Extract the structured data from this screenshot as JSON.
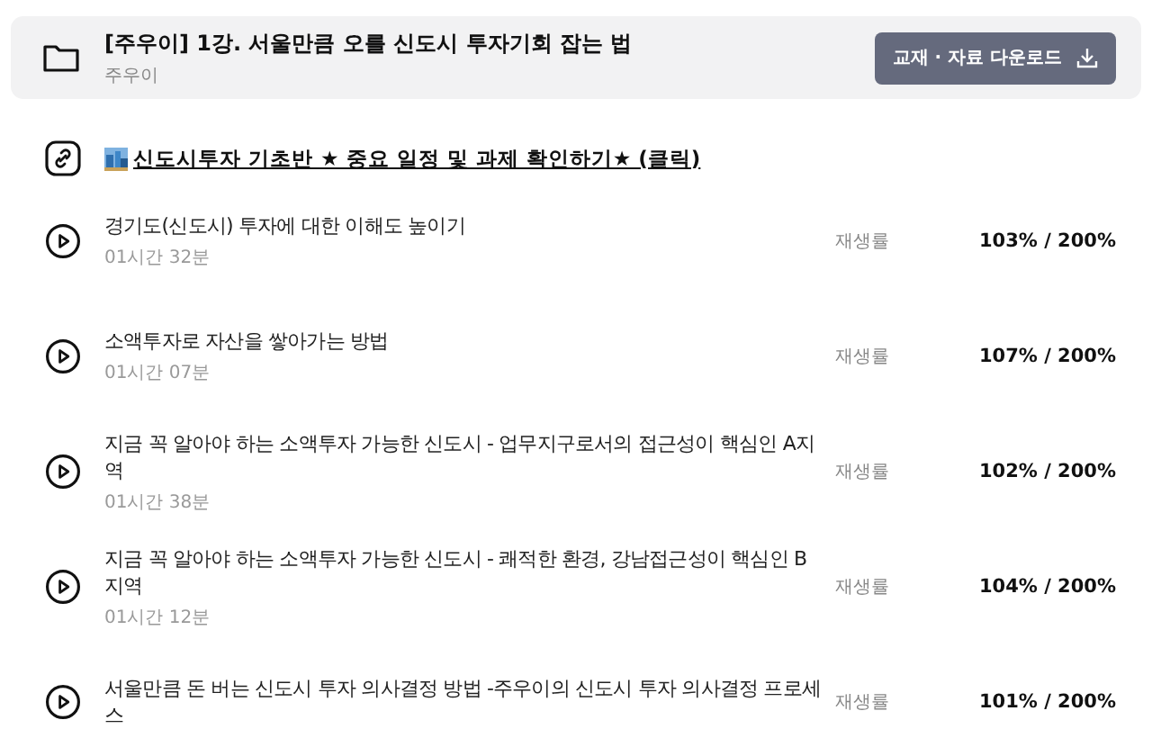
{
  "course": {
    "title": "[주우이] 1강. 서울만큼 오를 신도시 투자기회 잡는 법",
    "author": "주우이",
    "download_button": "교재 · 자료 다운로드"
  },
  "link": {
    "text": "신도시투자 기초반 ★ 중요 일정 및 과제 확인하기★ (클릭)"
  },
  "lessons": [
    {
      "title": "경기도(신도시) 투자에 대한 이해도 높이기",
      "duration": "01시간 32분",
      "rate_label": "재생률",
      "rate": "103% / 200%"
    },
    {
      "title": "소액투자로 자산을 쌓아가는 방법",
      "duration": "01시간 07분",
      "rate_label": "재생률",
      "rate": "107% / 200%"
    },
    {
      "title": "지금 꼭 알아야 하는 소액투자 가능한 신도시 - 업무지구로서의 접근성이 핵심인 A지역",
      "duration": "01시간 38분",
      "rate_label": "재생률",
      "rate": "102% / 200%"
    },
    {
      "title": "지금 꼭 알아야 하는 소액투자 가능한 신도시 - 쾌적한 환경, 강남접근성이 핵심인 B지역",
      "duration": "01시간 12분",
      "rate_label": "재생률",
      "rate": "104% / 200%"
    },
    {
      "title": "서울만큼 돈 버는 신도시 투자 의사결정 방법 -주우이의 신도시 투자 의사결정 프로세스",
      "rate_label": "재생률",
      "rate": "101% / 200%"
    }
  ]
}
